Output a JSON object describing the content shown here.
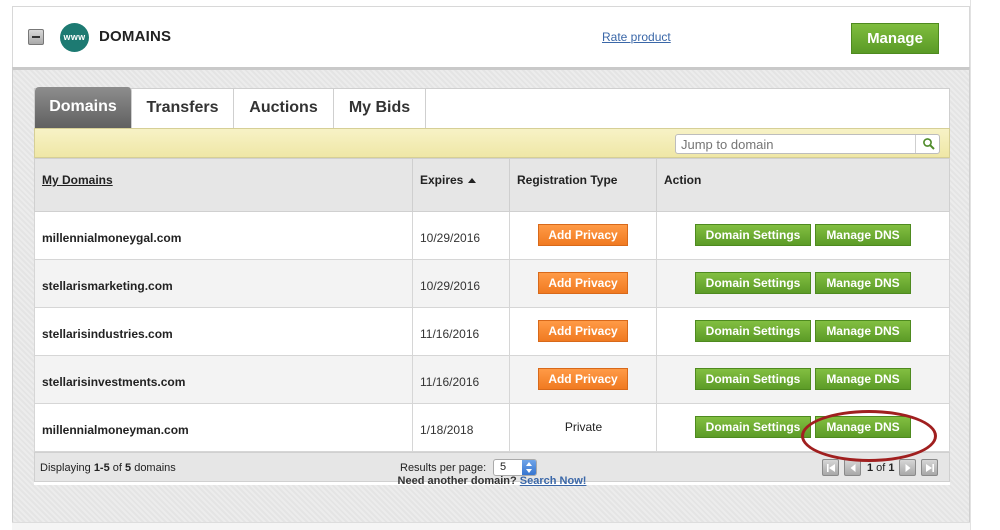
{
  "header": {
    "title": "DOMAINS",
    "icon_text": "www",
    "rate_link": "Rate product",
    "manage_button": "Manage"
  },
  "tabs": [
    {
      "label": "Domains",
      "active": true
    },
    {
      "label": "Transfers",
      "active": false
    },
    {
      "label": "Auctions",
      "active": false
    },
    {
      "label": "My Bids",
      "active": false
    }
  ],
  "jump": {
    "placeholder": "Jump to domain"
  },
  "table": {
    "headers": {
      "domain": "My Domains",
      "expires": "Expires",
      "registration": "Registration Type",
      "action": "Action"
    },
    "rows": [
      {
        "domain": "millennialmoneygal.com",
        "expires": "10/29/2016",
        "registration": "Add Privacy",
        "settings": "Domain Settings",
        "dns": "Manage DNS"
      },
      {
        "domain": "stellarismarketing.com",
        "expires": "10/29/2016",
        "registration": "Add Privacy",
        "settings": "Domain Settings",
        "dns": "Manage DNS"
      },
      {
        "domain": "stellarisindustries.com",
        "expires": "11/16/2016",
        "registration": "Add Privacy",
        "settings": "Domain Settings",
        "dns": "Manage DNS"
      },
      {
        "domain": "stellarisinvestments.com",
        "expires": "11/16/2016",
        "registration": "Add Privacy",
        "settings": "Domain Settings",
        "dns": "Manage DNS"
      },
      {
        "domain": "millennialmoneyman.com",
        "expires": "1/18/2018",
        "registration": "Private",
        "settings": "Domain Settings",
        "dns": "Manage DNS"
      }
    ]
  },
  "footer": {
    "displaying_prefix": "Displaying ",
    "displaying_range": "1-5",
    "displaying_of": " of ",
    "displaying_total": "5",
    "displaying_suffix": " domains",
    "results_per_page_label": "Results per page:",
    "results_per_page_value": "5",
    "page_current": "1",
    "page_of": " of ",
    "page_total": "1"
  },
  "need_more": {
    "text": "Need another domain? ",
    "link": "Search Now!"
  },
  "colors": {
    "green_button": "#5c9b27",
    "orange_button": "#f07a21",
    "highlight_ring": "#a01f1f",
    "link": "#3a67a8"
  }
}
